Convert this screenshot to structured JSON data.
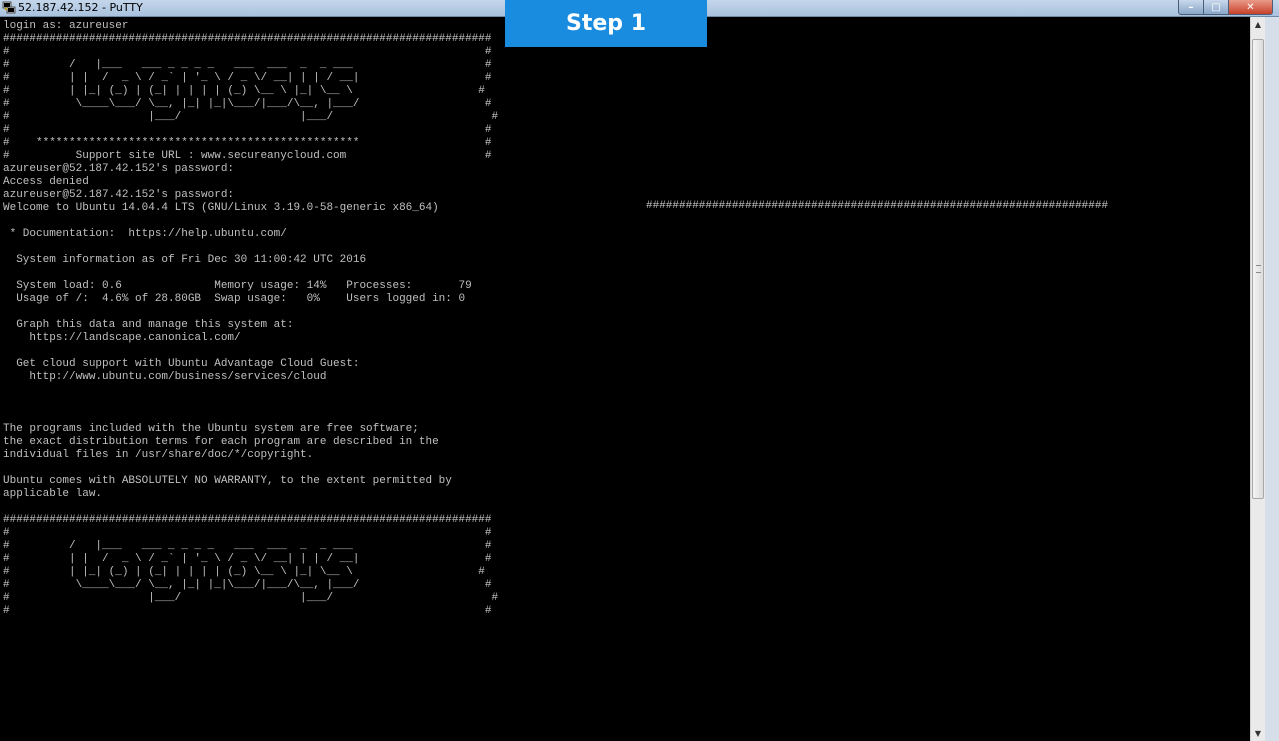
{
  "window": {
    "title": "52.187.42.152 - PuTTY",
    "buttons": {
      "minimize": "–",
      "maximize": "□",
      "close": "✕"
    }
  },
  "overlay": {
    "step_label": "Step 1"
  },
  "terminal": {
    "text": "login as: azureuser\n##########################################################################\n#                                                                        #\n#         /   |___   ___ _ _ _ _   ___  ___  _  _ ___                    #\n#         | |  /  _ \\ / _` | '_ \\ / _ \\/ __| | | / __|                   #\n#         | |_| (_) | (_| | | | | (_) \\__ \\ |_| \\__ \\                   #\n#          \\____\\___/ \\__, |_| |_|\\___/|___/\\__, |___/                   #\n#                     |___/                  |___/                        #\n#                                                                        #\n#    *************************************************                   #\n#          Support site URL : www.secureanycloud.com                     #\nazureuser@52.187.42.152's password:\nAccess denied\nazureuser@52.187.42.152's password:\nWelcome to Ubuntu 14.04.4 LTS (GNU/Linux 3.19.0-58-generic x86_64)\n\n * Documentation:  https://help.ubuntu.com/\n\n  System information as of Fri Dec 30 11:00:42 UTC 2016\n\n  System load: 0.6              Memory usage: 14%   Processes:       79\n  Usage of /:  4.6% of 28.80GB  Swap usage:   0%    Users logged in: 0\n\n  Graph this data and manage this system at:\n    https://landscape.canonical.com/\n\n  Get cloud support with Ubuntu Advantage Cloud Guest:\n    http://www.ubuntu.com/business/services/cloud\n\n\n\nThe programs included with the Ubuntu system are free software;\nthe exact distribution terms for each program are described in the\nindividual files in /usr/share/doc/*/copyright.\n\nUbuntu comes with ABSOLUTELY NO WARRANTY, to the extent permitted by\napplicable law.\n\n##########################################################################\n#                                                                        #\n#         /   |___   ___ _ _ _ _   ___  ___  _  _ ___                    #\n#         | |  /  _ \\ / _` | '_ \\ / _ \\/ __| | | / __|                   #\n#         | |_| (_) | (_| | | | | (_) \\__ \\ |_| \\__ \\                   #\n#          \\____\\___/ \\__, |_| |_|\\___/|___/\\__, |___/                   #\n#                     |___/                  |___/                        #\n#                                                                        #",
    "wrapped_hash_line": "######################################################################"
  },
  "scrollbar": {
    "up_arrow": "▲",
    "down_arrow": "▼"
  }
}
